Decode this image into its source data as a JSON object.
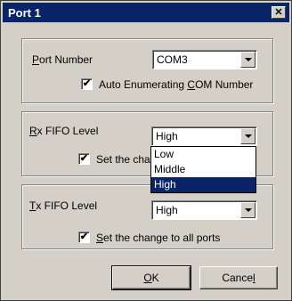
{
  "window": {
    "title": "Port 1",
    "close_glyph": "✕"
  },
  "port_group": {
    "label_prefix": "",
    "label_accel": "P",
    "label_rest": "ort Number",
    "combo_value": "COM3",
    "checkbox_checked": true,
    "checkbox_pre": "Auto Enumerating ",
    "checkbox_accel": "C",
    "checkbox_post": "OM Number"
  },
  "rx_group": {
    "label_accel": "R",
    "label_rest": "x FIFO Level",
    "combo_value": "High",
    "checkbox_checked": true,
    "checkbox_text_visible": "Set the cha",
    "dropdown_options": [
      "Low",
      "Middle",
      "High"
    ],
    "dropdown_selected_index": 2
  },
  "tx_group": {
    "label_accel": "T",
    "label_rest": "x FIFO Level",
    "combo_value": "High",
    "checkbox_checked": true,
    "checkbox_accel": "S",
    "checkbox_rest": "et the change to all ports"
  },
  "buttons": {
    "ok_accel": "O",
    "ok_rest": "K",
    "cancel_pre": "Cance",
    "cancel_accel": "l"
  },
  "check_glyph": "✔"
}
